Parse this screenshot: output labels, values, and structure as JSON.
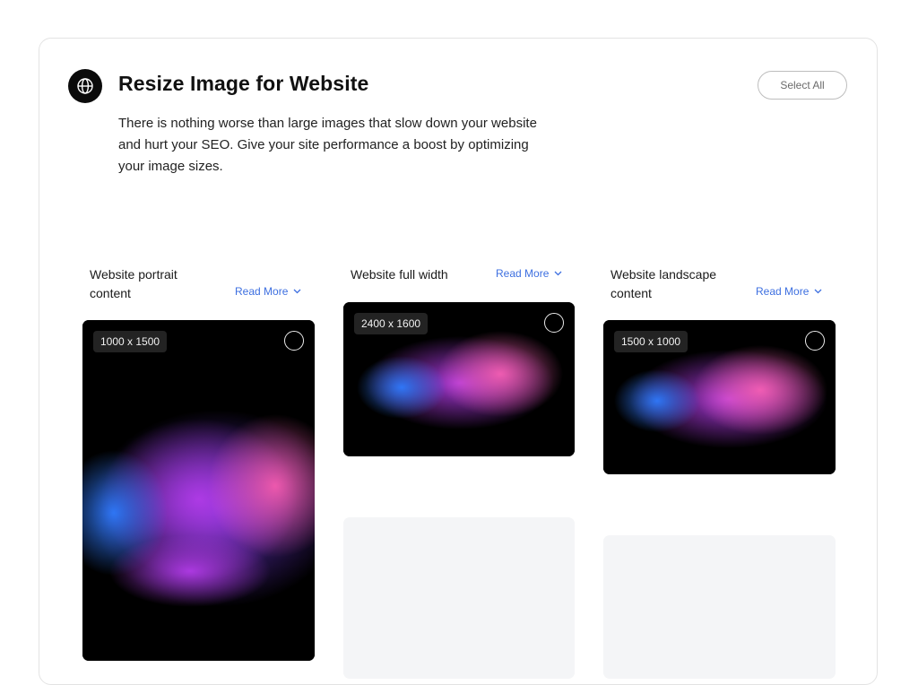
{
  "section": {
    "title": "Resize Image for Website",
    "description": "There is nothing worse than large images that slow down your website and hurt your SEO. Give your site performance a boost by optimizing your image sizes.",
    "select_all_label": "Select All",
    "icon": "globe-icon"
  },
  "columns": [
    {
      "label": "Website portrait content",
      "read_more": "Read More",
      "size_badge": "1000 x 1500"
    },
    {
      "label": "Website full width",
      "read_more": "Read More",
      "size_badge": "2400 x 1600"
    },
    {
      "label": "Website landscape content",
      "read_more": "Read More",
      "size_badge": "1500 x 1000"
    }
  ],
  "colors": {
    "accent_link": "#3d6fe0",
    "badge_bg": "#262626",
    "placeholder_bg": "#f4f5f7"
  }
}
